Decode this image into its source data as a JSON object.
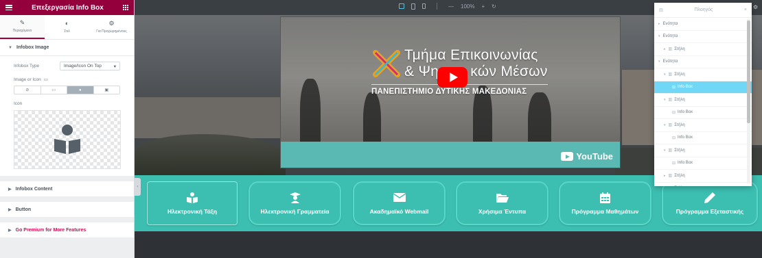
{
  "panel": {
    "title": "Επεξεργασία Info Box",
    "tabs": [
      {
        "label": "Περιεχόμενο",
        "icon": "pencil-icon"
      },
      {
        "label": "Στιλ",
        "icon": "contrast-icon"
      },
      {
        "label": "Για Προχωρημένους",
        "icon": "gear-icon"
      }
    ],
    "section_title": "Infobox Image",
    "infobox_type_label": "Infobox Type",
    "infobox_type_value": "Image/Icon On Top",
    "image_or_icon_label": "Image or Icon",
    "icon_label": "Icon",
    "collapsed_sections": [
      {
        "label": "Infobox Content"
      },
      {
        "label": "Button"
      },
      {
        "label": "Go Premium for More Features"
      }
    ]
  },
  "editor_bar": {
    "zoom": "100%",
    "plus": "+",
    "undo": "↻"
  },
  "video": {
    "title_line1": "Τμήμα Επικοινωνίας",
    "title_line2_prefix": "& Ψη",
    "title_line2_suffix": "κών Μέσων",
    "subtitle": "ΠΑΝΕΠΙΣΤΗΜΙΟ ΔΥΤΙΚΗΣ ΜΑΚΕΔΟΝΙΑΣ",
    "brand": "YouTube"
  },
  "services": [
    {
      "label": "Ηλεκτρονική Τάξη",
      "icon": "classroom-icon"
    },
    {
      "label": "Ηλεκτρονική Γραμματεία",
      "icon": "graduate-icon"
    },
    {
      "label": "Ακαδημαϊκό Webmail",
      "icon": "envelope-icon"
    },
    {
      "label": "Χρήσιμα Έντυπα",
      "icon": "folder-open-icon"
    },
    {
      "label": "Πρόγραμμα Μαθημάτων",
      "icon": "calendar-icon"
    },
    {
      "label": "Πρόγραμμα Εξεταστικής",
      "icon": "pencil-icon"
    }
  ],
  "navigator": {
    "title": "Πλοηγός",
    "items": [
      {
        "label": "Ενότητα",
        "indent": 0,
        "kind": "section"
      },
      {
        "label": "Ενότητα",
        "indent": 0,
        "kind": "section"
      },
      {
        "label": "Στήλη",
        "indent": 1,
        "kind": "column"
      },
      {
        "label": "Ενότητα",
        "indent": 0,
        "kind": "section"
      },
      {
        "label": "Στήλη",
        "indent": 1,
        "kind": "column"
      },
      {
        "label": "Info Box",
        "indent": 2,
        "kind": "widget",
        "active": true
      },
      {
        "label": "Στήλη",
        "indent": 1,
        "kind": "column"
      },
      {
        "label": "Info Box",
        "indent": 2,
        "kind": "widget"
      },
      {
        "label": "Στήλη",
        "indent": 1,
        "kind": "column"
      },
      {
        "label": "Info Box",
        "indent": 2,
        "kind": "widget"
      },
      {
        "label": "Στήλη",
        "indent": 1,
        "kind": "column"
      },
      {
        "label": "Info Box",
        "indent": 2,
        "kind": "widget"
      },
      {
        "label": "Στήλη",
        "indent": 1,
        "kind": "column"
      },
      {
        "label": "Στήλη",
        "indent": 1,
        "kind": "column"
      }
    ]
  },
  "colors": {
    "brand": "#93003c",
    "teal": "#3cbeb0",
    "navigator_active": "#71d7f7",
    "youtube_red": "#ff0000"
  }
}
